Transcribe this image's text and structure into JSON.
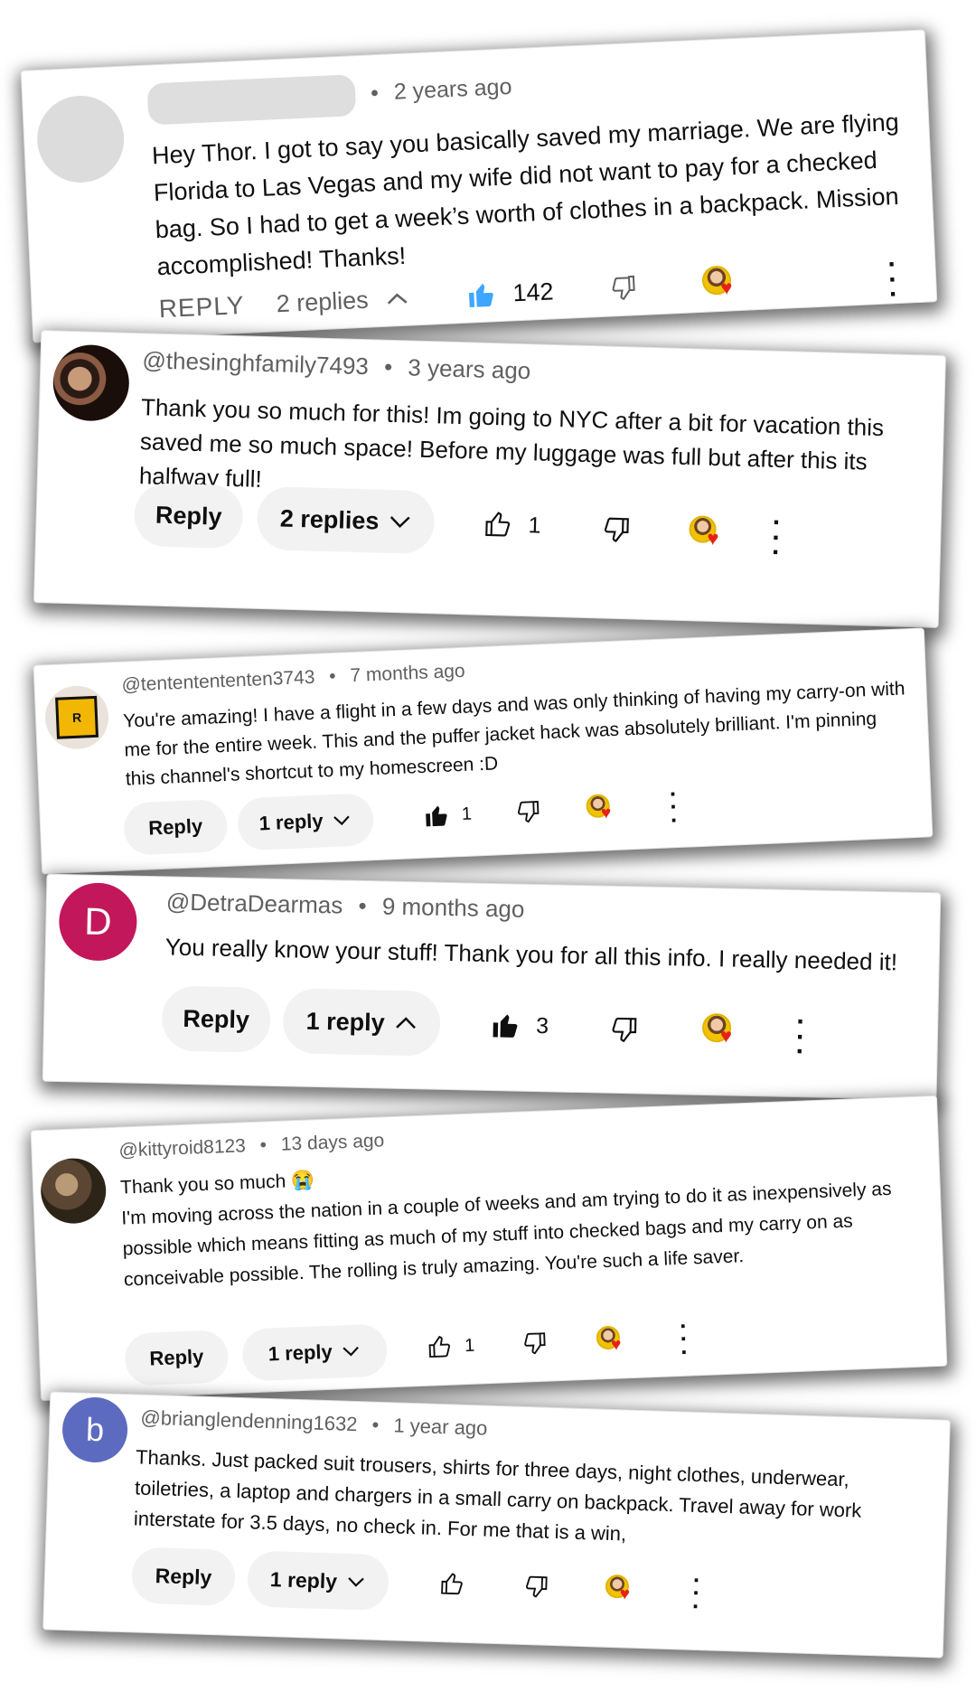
{
  "comments": [
    {
      "handle": "",
      "time": "2 years ago",
      "text": "Hey Thor. I got to say you basically saved my marriage. We are flying Florida to Las Vegas and my wife did not want to pay for a checked bag. So I had to get a week’s worth of clothes in a backpack. Mission accomplished! Thanks!",
      "reply_label": "REPLY",
      "replies_label": "2 replies",
      "likes": "142",
      "avatar_letter": ""
    },
    {
      "handle": "@thesinghfamily7493",
      "time": "3 years ago",
      "text": "Thank you so much for this! Im going to NYC after a bit for vacation this saved me so much space! Before my luggage was full but after this its halfway full!",
      "reply_label": "Reply",
      "replies_label": "2 replies",
      "likes": "1",
      "avatar_letter": ""
    },
    {
      "handle": "@tententententen3743",
      "time": "7 months ago",
      "text": "You're amazing! I have a flight in a few days and was only thinking of having my carry-on with me for the entire week. This and the puffer jacket hack was absolutely brilliant. I'm pinning this channel's shortcut to my homescreen :D",
      "reply_label": "Reply",
      "replies_label": "1 reply",
      "likes": "1",
      "avatar_letter": "R"
    },
    {
      "handle": "@DetraDearmas",
      "time": "9 months ago",
      "text": "You really know your stuff! Thank you for all this info. I really needed it!",
      "reply_label": "Reply",
      "replies_label": "1 reply",
      "likes": "3",
      "avatar_letter": "D"
    },
    {
      "handle": "@kittyroid8123",
      "time": "13 days ago",
      "text_line1": "Thank you so much 😭",
      "text": "I'm moving across the nation in a couple of weeks and am trying to do it as inexpensively as possible which means fitting as much of my stuff into checked bags and my carry on as conceivable possible. The rolling is truly amazing. You're such a life saver.",
      "reply_label": "Reply",
      "replies_label": "1 reply",
      "likes": "1",
      "avatar_letter": ""
    },
    {
      "handle": "@brianglendenning1632",
      "time": "1 year ago",
      "text": "Thanks.  Just packed suit trousers, shirts for three days, night clothes, underwear, toiletries, a laptop and chargers in a small carry on backpack. Travel away for work interstate for 3.5 days, no check in. For me that is a win,",
      "reply_label": "Reply",
      "replies_label": "1 reply",
      "likes": "",
      "avatar_letter": "b"
    }
  ],
  "colors": {
    "like_filled": "#3ea6ff",
    "avatar_d": "#c2185b",
    "avatar_b": "#5c6bc0",
    "heart": "#e62117"
  }
}
